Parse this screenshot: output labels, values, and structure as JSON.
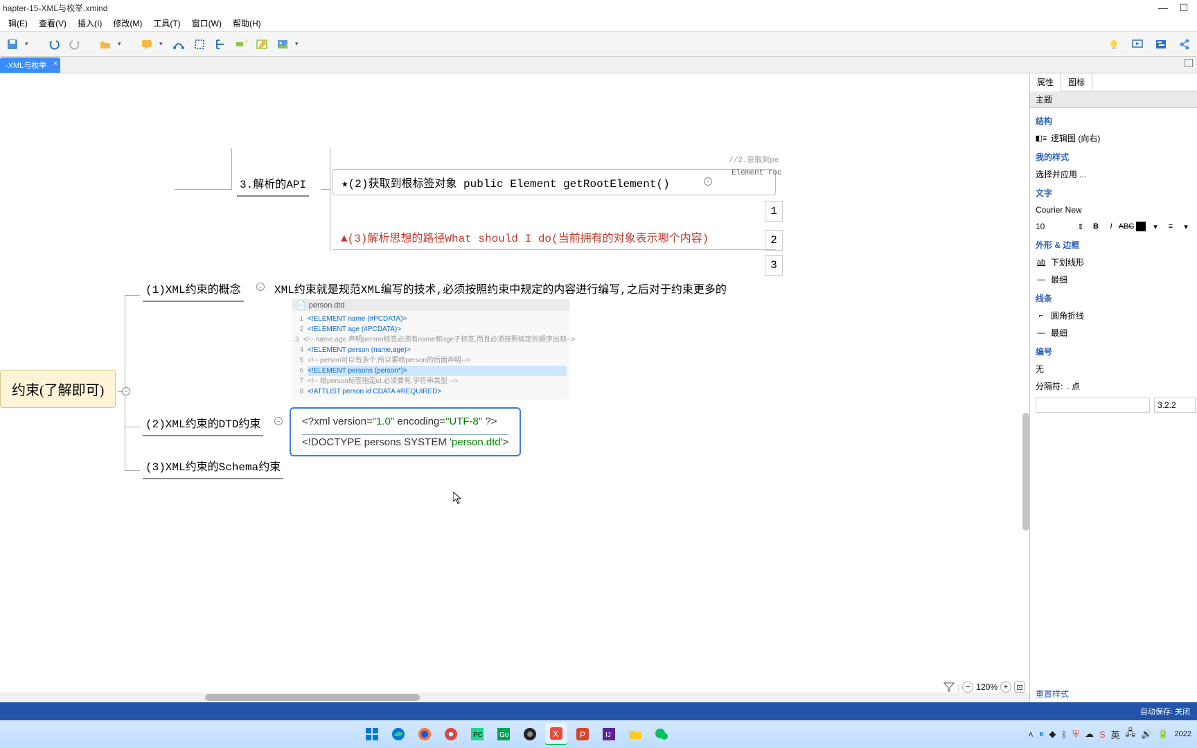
{
  "title": "hapter-15-XML与枚举.xmind",
  "menu": [
    "辑(E)",
    "查看(V)",
    "插入(I)",
    "修改(M)",
    "工具(T)",
    "窗口(W)",
    "帮助(H)"
  ],
  "tab": {
    "label": "-XML与枚举"
  },
  "nodes": {
    "api": "3.解析的API",
    "root_el": "★(2)获取到根标签对象 public Element getRootElement()",
    "route": "▲(3)解析思想的路径What should I do(当前拥有的对象表示哪个内容)",
    "c1": "(1)XML约束的概念",
    "c1_desc": "XML约束就是规范XML编写的技术,必须按照约束中规定的内容进行编写,之后对于约束更多的",
    "c2": "(2)XML约束的DTD约束",
    "c3": "(3)XML约束的Schema约束",
    "central": "约束(了解即可)",
    "snip1": "//2.获取到pe",
    "snip2": "Element roc",
    "side_nums": [
      "1",
      "2",
      "3"
    ]
  },
  "dtd_file": "person.dtd",
  "dtd": [
    {
      "n": "1",
      "t": "<!ELEMENT name (#PCDATA)>",
      "cls": "kw"
    },
    {
      "n": "2",
      "t": "<!ELEMENT age (#PCDATA)>",
      "cls": "kw"
    },
    {
      "n": "3",
      "t": "<!-- name,age 声明person标签必须有name和age子标签,而且必须按照规定的顺序出现-->",
      "cls": "cm"
    },
    {
      "n": "4",
      "t": "<!ELEMENT person (name,age)>",
      "cls": "kw"
    },
    {
      "n": "5",
      "t": "<!-- person可以有多个,所以要给person的后面声明-->",
      "cls": "cm"
    },
    {
      "n": "6",
      "t": "<!ELEMENT persons (person*)>",
      "cls": "kw hl"
    },
    {
      "n": "7",
      "t": "<!-- 给person标签指定id,必须要有,字符串类型 -->",
      "cls": "cm"
    },
    {
      "n": "8",
      "t": "<!ATTLIST person id CDATA #REQUIRED>",
      "cls": "kw"
    }
  ],
  "xmlbox": {
    "l1_a": "<?xml version=",
    "l1_b": "\"1.0\"",
    "l1_c": " encoding=",
    "l1_d": "\"UTF-8\"",
    "l1_e": " ?>",
    "l2_a": "<!DOCTYPE persons SYSTEM ",
    "l2_b": "'person.dtd'",
    "l2_c": ">"
  },
  "zoom": "120%",
  "panel": {
    "tabs": [
      "属性",
      "图标"
    ],
    "topic": "主题",
    "s_struct": "结构",
    "struct_val": "逻辑图 (向右)",
    "s_style": "我的样式",
    "style_val": "选择并应用 ...",
    "s_text": "文字",
    "font": "Courier New",
    "size": "10",
    "s_shape": "外形 & 边框",
    "shape_v1": "下划线形",
    "shape_v2": "最细",
    "s_line": "线条",
    "line_v1": "圆角折线",
    "line_v2": "最细",
    "s_num": "编号",
    "num_v": "无",
    "sep_label": "分隔符:",
    "sep_v": ". 点",
    "num_box": "3.2.2",
    "reset": "重置样式"
  },
  "status": {
    "autosave": "自动保存: 关闭"
  },
  "tray": {
    "year": "2022"
  }
}
